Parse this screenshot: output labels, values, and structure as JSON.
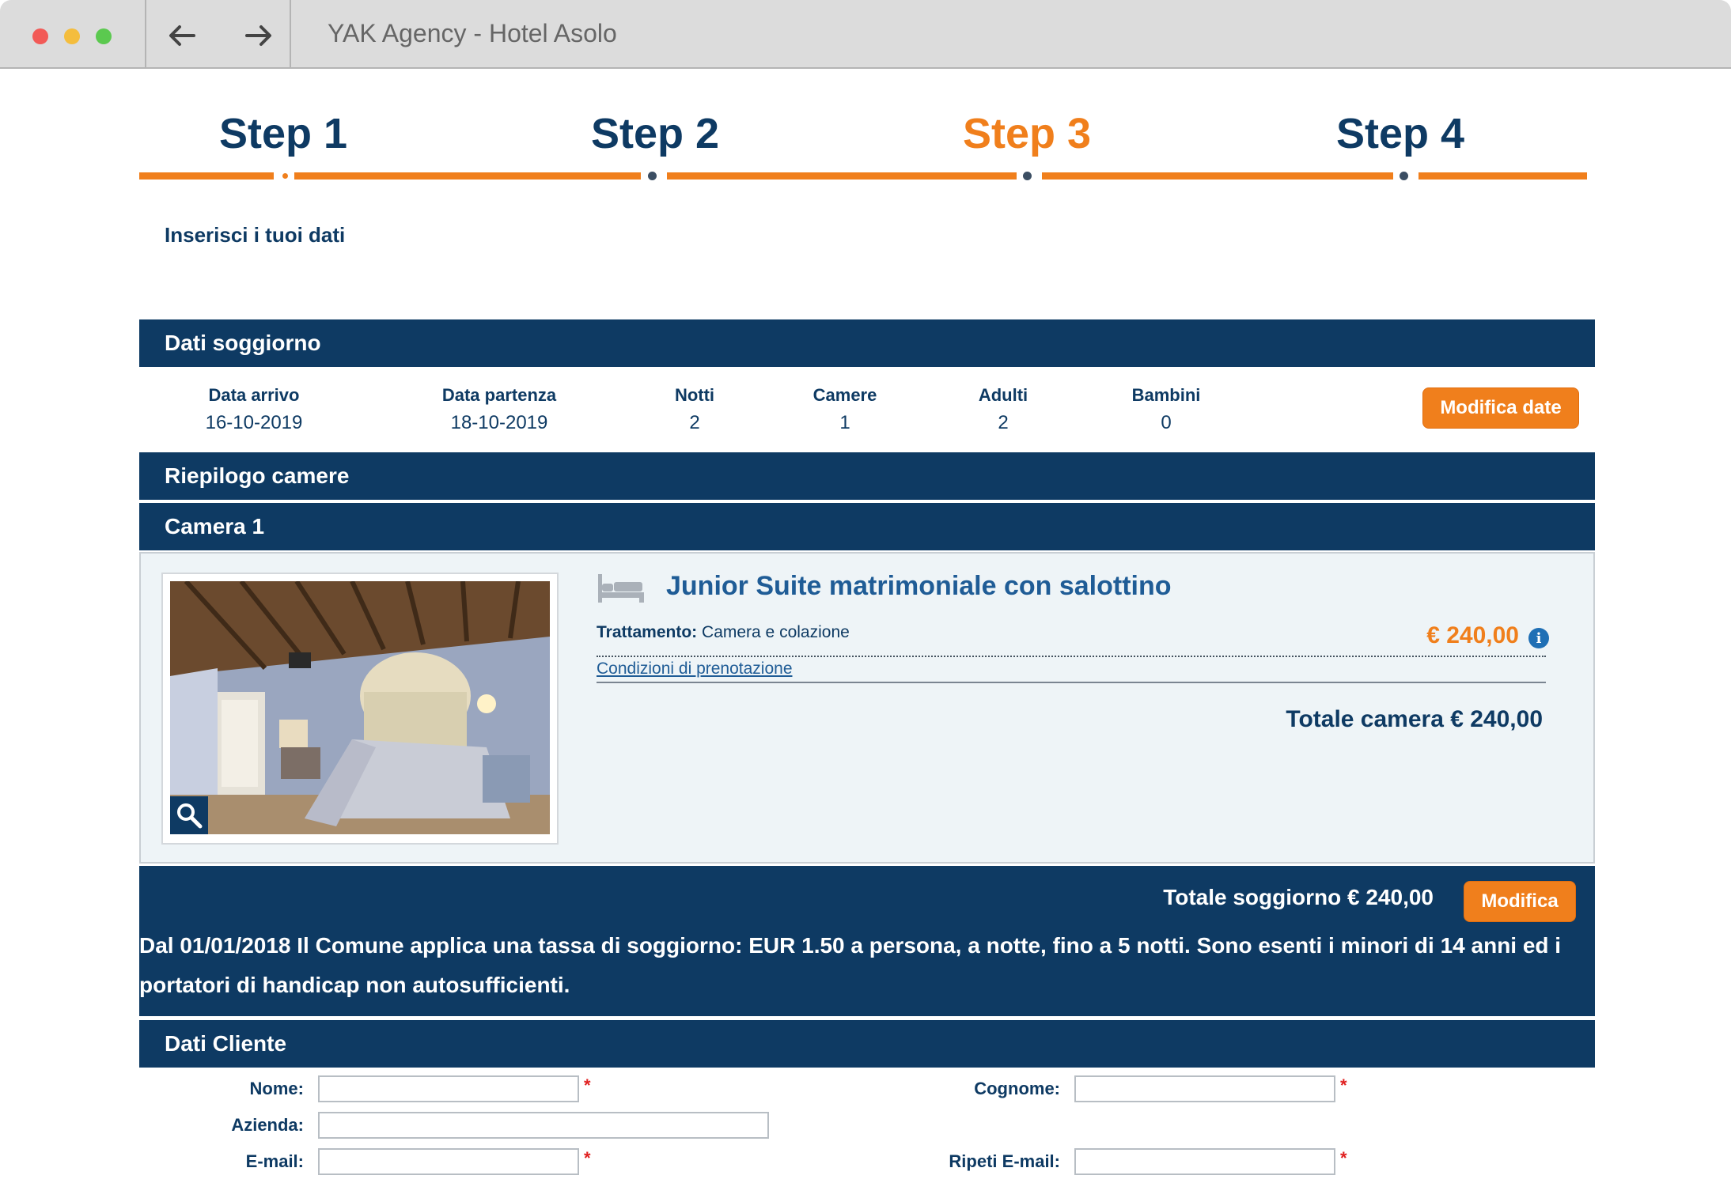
{
  "window": {
    "title": "YAK Agency - Hotel Asolo"
  },
  "steps": [
    {
      "label": "Step 1"
    },
    {
      "label": "Step 2"
    },
    {
      "label": "Step 3"
    },
    {
      "label": "Step 4"
    }
  ],
  "active_step": 3,
  "intro": "Inserisci i tuoi dati",
  "stay": {
    "header": "Dati soggiorno",
    "fields": [
      {
        "label": "Data arrivo",
        "value": "16-10-2019"
      },
      {
        "label": "Data partenza",
        "value": "18-10-2019"
      },
      {
        "label": "Notti",
        "value": "2"
      },
      {
        "label": "Camere",
        "value": "1"
      },
      {
        "label": "Adulti",
        "value": "2"
      },
      {
        "label": "Bambini",
        "value": "0"
      }
    ],
    "edit_button": "Modifica date"
  },
  "rooms_summary": {
    "header": "Riepilogo camere",
    "room_header": "Camera 1",
    "room": {
      "name": "Junior Suite matrimoniale con salottino",
      "treatment_label": "Trattamento:",
      "treatment_value": "Camera e colazione",
      "price": "€ 240,00",
      "conditions_link": "Condizioni di prenotazione",
      "total": "Totale camera € 240,00"
    }
  },
  "summary": {
    "total": "Totale soggiorno € 240,00",
    "edit_button": "Modifica",
    "tax_notice": "Dal 01/01/2018 Il Comune applica una tassa di soggiorno: EUR 1.50 a persona, a notte, fino a 5 notti. Sono esenti i minori di 14 anni ed i portatori di handicap non autosufficienti."
  },
  "client": {
    "header": "Dati Cliente",
    "fields": {
      "nome": {
        "label": "Nome:",
        "value": "",
        "required": "*"
      },
      "cognome": {
        "label": "Cognome:",
        "value": "",
        "required": "*"
      },
      "azienda": {
        "label": "Azienda:",
        "value": ""
      },
      "email": {
        "label": "E-mail:",
        "value": "",
        "required": "*"
      },
      "email_repeat": {
        "label": "Ripeti E-mail:",
        "value": "",
        "required": "*"
      }
    }
  },
  "colors": {
    "navy": "#0e3a63",
    "orange": "#f07f1c",
    "link_blue": "#1f5c96"
  },
  "icons": {
    "back": "arrow-left-icon",
    "forward": "arrow-right-icon",
    "bed": "bed-icon",
    "zoom": "magnifier-icon",
    "info": "info-icon"
  }
}
